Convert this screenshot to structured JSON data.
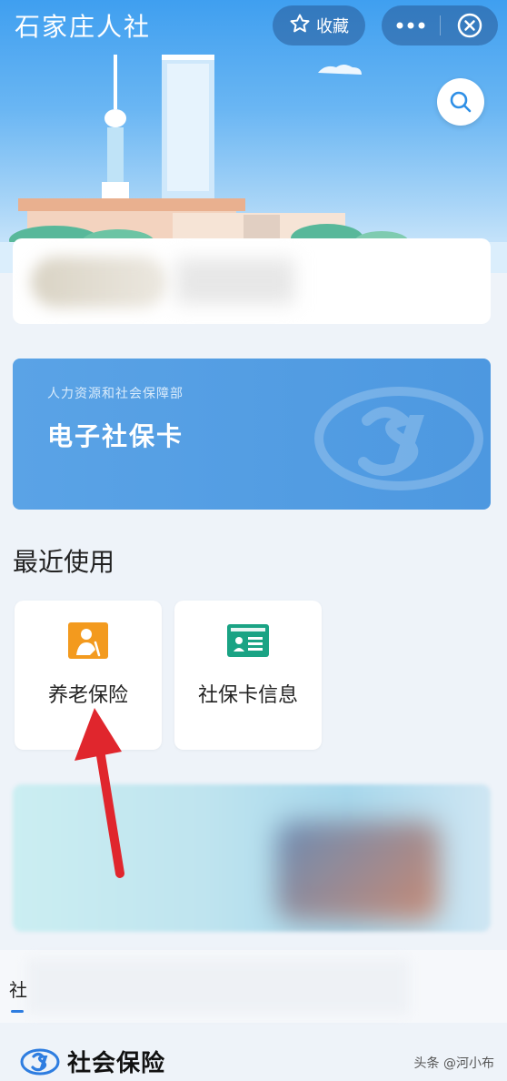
{
  "header": {
    "title": "石家庄人社",
    "favorite_label": "收藏",
    "more_icon": "more-dots-icon",
    "close_icon": "close-circle-icon",
    "search_icon": "search-icon"
  },
  "ecard": {
    "subtitle": "人力资源和社会保障部",
    "title": "电子社保卡",
    "watermark_icon": "si-logo-icon"
  },
  "recent": {
    "title": "最近使用",
    "items": [
      {
        "label": "养老保险",
        "icon": "pension-person-icon",
        "color": "#f39a1e"
      },
      {
        "label": "社保卡信息",
        "icon": "id-card-icon",
        "color": "#1aa384"
      }
    ]
  },
  "tabs": {
    "first_label": "社"
  },
  "footer": {
    "section_title": "社会保险",
    "attribution": "头条 @河小布"
  },
  "colors": {
    "accent": "#2e7de0",
    "card_blue": "#5aa3e6",
    "arrow_red": "#e0262d"
  }
}
